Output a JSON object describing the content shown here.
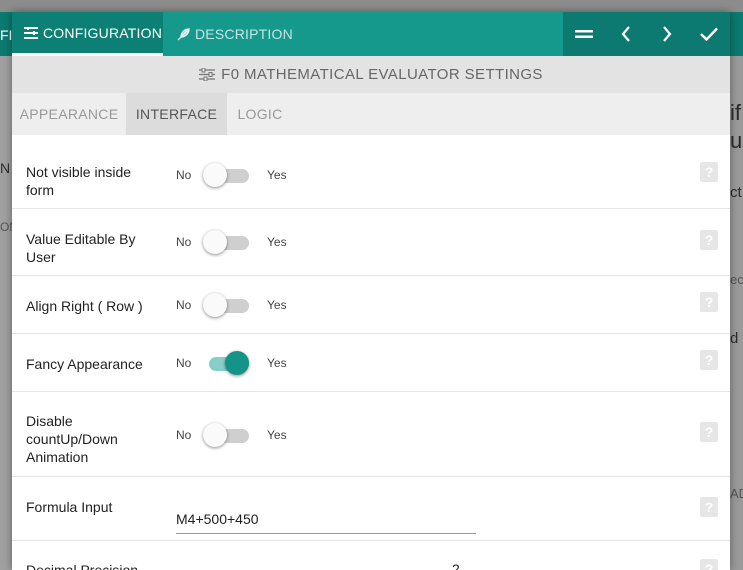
{
  "background": {
    "fragments": [
      "FIG",
      "N",
      "ON",
      "if",
      "u",
      "ct",
      "ec",
      "d",
      "AD"
    ]
  },
  "tabs": [
    {
      "label": "CONFIGURATION",
      "icon": "list-settings-icon",
      "active": true
    },
    {
      "label": "DESCRIPTION",
      "icon": "feather-icon",
      "active": false
    }
  ],
  "toolbar": {
    "icons": [
      "drag-handle-icon",
      "chevron-left-icon",
      "chevron-right-icon",
      "check-icon"
    ]
  },
  "header": {
    "title": "F0 MATHEMATICAL EVALUATOR SETTINGS",
    "icon": "sliders-icon"
  },
  "subtabs": [
    {
      "label": "APPEARANCE",
      "active": false
    },
    {
      "label": "INTERFACE",
      "active": true
    },
    {
      "label": "LOGIC",
      "active": false
    }
  ],
  "settings": [
    {
      "label": "Not visible inside form",
      "no": "No",
      "yes": "Yes",
      "value": false
    },
    {
      "label": "Value Editable By User",
      "no": "No",
      "yes": "Yes",
      "value": false
    },
    {
      "label": "Align Right ( Row )",
      "no": "No",
      "yes": "Yes",
      "value": false
    },
    {
      "label": "Fancy Appearance",
      "no": "No",
      "yes": "Yes",
      "value": true
    },
    {
      "label": "Disable countUp/Down Animation",
      "no": "No",
      "yes": "Yes",
      "value": false
    }
  ],
  "formula": {
    "label": "Formula Input",
    "value": "M4+500+450"
  },
  "decimal": {
    "label": "Decimal Precision",
    "value": "2"
  },
  "help_text": "?",
  "colors": {
    "accent": "#14998c",
    "accent_dark": "#0c7a70",
    "toggle_on": "#139487"
  }
}
